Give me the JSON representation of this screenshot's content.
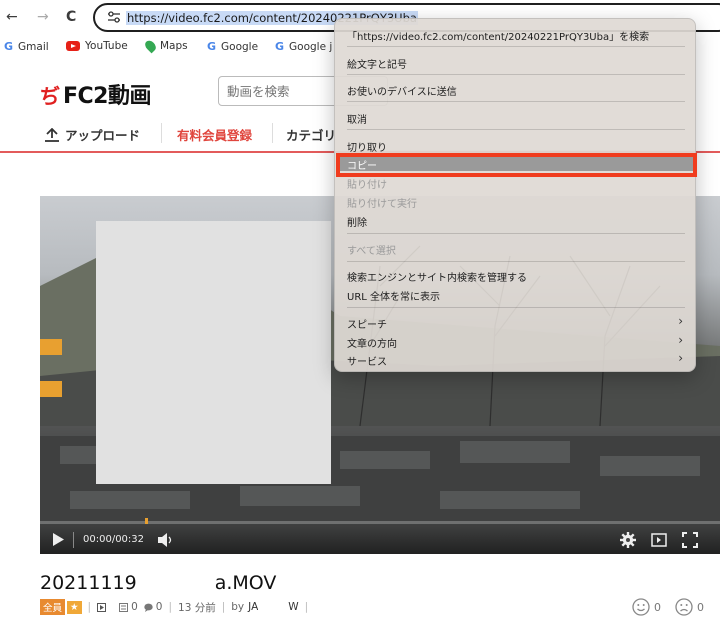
{
  "browser": {
    "back_icon": "←",
    "forward_icon": "→",
    "reload_icon": "C",
    "url": "https://video.fc2.com/content/20240221PrQY3Uba"
  },
  "bookmarks": [
    {
      "label": "Gmail",
      "icon": "google-g"
    },
    {
      "label": "YouTube",
      "icon": "youtube"
    },
    {
      "label": "Maps",
      "icon": "maps-pin"
    },
    {
      "label": "Google",
      "icon": "google-g"
    },
    {
      "label": "Google j",
      "icon": "google-g"
    }
  ],
  "site": {
    "logo_mark": "ぢ",
    "logo_text": "FC2動画",
    "search_placeholder": "動画を検索",
    "nav": {
      "upload": "アップロード",
      "premium": "有料会員登録",
      "category": "カテゴリ"
    },
    "accent_color": "#e35b5b"
  },
  "video": {
    "time": "00:00/00:32",
    "title_prefix": "20211119",
    "title_suffix": "a.MOV",
    "member_label": "全員",
    "star": "★",
    "play_count": "0",
    "comment_count": "0",
    "posted": "13 分前",
    "by_label": "by",
    "author_start": "JA",
    "author_end": "W",
    "like_count": "0",
    "dislike_count": "0"
  },
  "context_menu": {
    "items": [
      {
        "label": "「https://video.fc2.com/content/20240221PrQY3Uba」を検索",
        "disabled": false
      },
      {
        "label": "絵文字と記号",
        "disabled": false
      },
      {
        "label": "お使いのデバイスに送信",
        "disabled": false
      },
      {
        "label": "取消",
        "disabled": false
      },
      {
        "label": "切り取り",
        "disabled": false
      },
      {
        "label": "コピー",
        "disabled": false,
        "highlighted": true
      },
      {
        "label": "貼り付け",
        "disabled": true
      },
      {
        "label": "貼り付けて実行",
        "disabled": true
      },
      {
        "label": "削除",
        "disabled": false
      },
      {
        "label": "すべて選択",
        "disabled": true
      },
      {
        "label": "検索エンジンとサイト内検索を管理する",
        "disabled": false
      },
      {
        "label": "URL 全体を常に表示",
        "disabled": false
      },
      {
        "label": "スピーチ",
        "disabled": false,
        "submenu": true
      },
      {
        "label": "文章の方向",
        "disabled": false,
        "submenu": true
      },
      {
        "label": "サービス",
        "disabled": false,
        "submenu": true
      }
    ],
    "submenu_arrow": "›",
    "highlight_outline_color": "#f03c1e"
  }
}
